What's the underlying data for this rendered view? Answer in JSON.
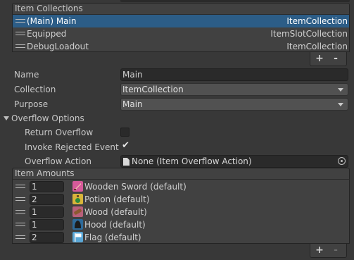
{
  "collections": {
    "header": "Item Collections",
    "rows": [
      {
        "name": "(Main) Main",
        "type": "ItemCollection",
        "selected": true
      },
      {
        "name": "Equipped",
        "type": "ItemSlotCollection",
        "selected": false
      },
      {
        "name": "DebugLoadout",
        "type": "ItemCollection",
        "selected": false
      }
    ],
    "add_label": "+",
    "remove_label": "-"
  },
  "properties": {
    "name_label": "Name",
    "name_value": "Main",
    "collection_label": "Collection",
    "collection_value": "ItemCollection",
    "purpose_label": "Purpose",
    "purpose_value": "Main"
  },
  "overflow": {
    "foldout_label": "Overflow Options",
    "return_overflow_label": "Return Overflow",
    "return_overflow_checked": false,
    "invoke_rejected_label": "Invoke Rejected Event",
    "invoke_rejected_checked": true,
    "check_glyph": "✔",
    "overflow_action_label": "Overflow Action",
    "overflow_action_value": "None (Item Overflow Action)"
  },
  "amounts": {
    "header": "Item Amounts",
    "rows": [
      {
        "amount": "1",
        "name": "Wooden Sword (default)",
        "icon": "sword-icon",
        "icon_color": "#d65a9a"
      },
      {
        "amount": "2",
        "name": "Potion (default)",
        "icon": "potion-icon",
        "icon_color": "#d8b53a"
      },
      {
        "amount": "1",
        "name": "Wood (default)",
        "icon": "wood-icon",
        "icon_color": "#b8607a"
      },
      {
        "amount": "1",
        "name": "Hood (default)",
        "icon": "hood-icon",
        "icon_color": "#2d6a9a"
      },
      {
        "amount": "2",
        "name": "Flag (default)",
        "icon": "flag-icon",
        "icon_color": "#5aa7d6"
      }
    ],
    "add_label": "+",
    "remove_label": "-"
  },
  "colors": {
    "background": "#383838",
    "panel": "#414141",
    "selection": "#2c5d87",
    "field": "#2a2a2a"
  }
}
